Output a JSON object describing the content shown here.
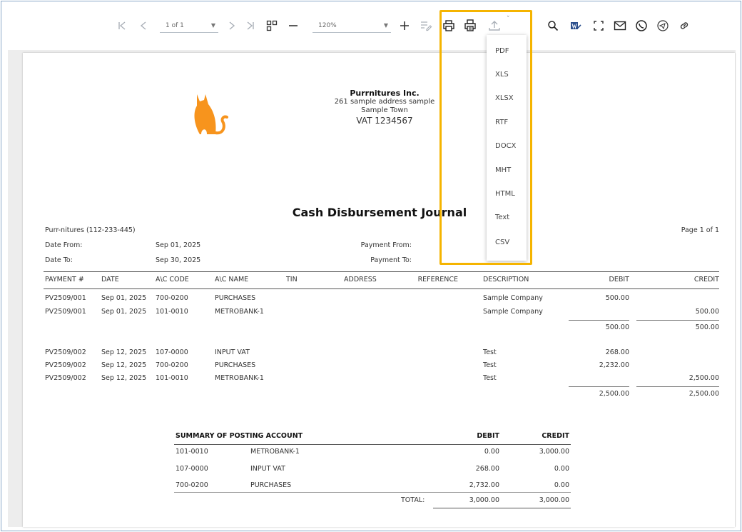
{
  "toolbar": {
    "page_select": "1 of 1",
    "zoom_select": "120%",
    "export_caret": "˅"
  },
  "export_menu": [
    "PDF",
    "XLS",
    "XLSX",
    "RTF",
    "DOCX",
    "MHT",
    "HTML",
    "Text",
    "CSV"
  ],
  "colors": {
    "highlight": "#f5b400",
    "logo": "#f7941d"
  },
  "report": {
    "company": "Purrnitures Inc.",
    "address1": "261 sample address sample",
    "address2": "Sample Town",
    "vat": "VAT 1234567",
    "title": "Cash Disbursement Journal",
    "entity": "Purr-nitures (112-233-445)",
    "page": "Page 1 of 1",
    "date_from_label": "Date From:",
    "date_from": "Sep 01, 2025",
    "date_to_label": "Date To:",
    "date_to": "Sep 30, 2025",
    "payment_from_label": "Payment From:",
    "payment_to_label": "Payment To:",
    "columns": [
      "PAYMENT #",
      "DATE",
      "A\\C CODE",
      "A\\C NAME",
      "TIN",
      "ADDRESS",
      "REFERENCE",
      "DESCRIPTION",
      "DEBIT",
      "CREDIT"
    ],
    "rows": [
      {
        "payment": "PV2509/001",
        "date": "Sep 01, 2025",
        "code": "700-0200",
        "name": "PURCHASES",
        "desc": "Sample Company",
        "debit": "500.00",
        "credit": ""
      },
      {
        "payment": "PV2509/001",
        "date": "Sep 01, 2025",
        "code": "101-0010",
        "name": "METROBANK-1",
        "desc": "Sample Company",
        "debit": "",
        "credit": "500.00"
      },
      {
        "payment": "PV2509/002",
        "date": "Sep 12, 2025",
        "code": "107-0000",
        "name": "INPUT VAT",
        "desc": "Test",
        "debit": "268.00",
        "credit": ""
      },
      {
        "payment": "PV2509/002",
        "date": "Sep 12, 2025",
        "code": "700-0200",
        "name": "PURCHASES",
        "desc": "Test",
        "debit": "2,232.00",
        "credit": ""
      },
      {
        "payment": "PV2509/002",
        "date": "Sep 12, 2025",
        "code": "101-0010",
        "name": "METROBANK-1",
        "desc": "Test",
        "debit": "",
        "credit": "2,500.00"
      }
    ],
    "subtotals": [
      {
        "debit": "500.00",
        "credit": "500.00"
      },
      {
        "debit": "2,500.00",
        "credit": "2,500.00"
      }
    ],
    "summary": {
      "title": "SUMMARY OF POSTING ACCOUNT",
      "debit_header": "DEBIT",
      "credit_header": "CREDIT",
      "rows": [
        {
          "code": "101-0010",
          "name": "METROBANK-1",
          "debit": "0.00",
          "credit": "3,000.00"
        },
        {
          "code": "107-0000",
          "name": "INPUT VAT",
          "debit": "268.00",
          "credit": "0.00"
        },
        {
          "code": "700-0200",
          "name": "PURCHASES",
          "debit": "2,732.00",
          "credit": "0.00"
        }
      ],
      "total_label": "TOTAL:",
      "total_debit": "3,000.00",
      "total_credit": "3,000.00"
    }
  }
}
